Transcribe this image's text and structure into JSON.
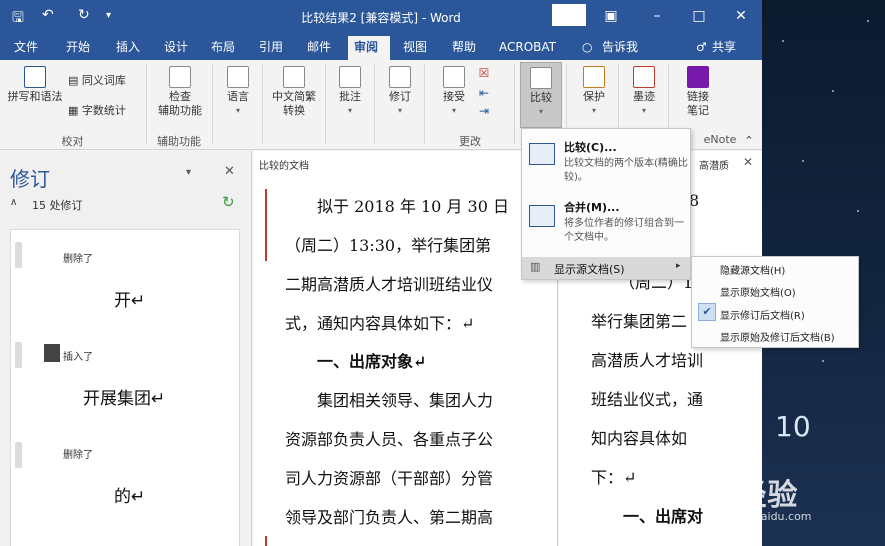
{
  "window": {
    "title": "比较结果2 [兼容模式] - Word",
    "tabs": [
      {
        "label": "文件"
      },
      {
        "label": "开始"
      },
      {
        "label": "插入"
      },
      {
        "label": "设计"
      },
      {
        "label": "布局"
      },
      {
        "label": "引用"
      },
      {
        "label": "邮件"
      },
      {
        "label": "审阅"
      },
      {
        "label": "视图"
      },
      {
        "label": "帮助"
      },
      {
        "label": "ACROBAT"
      },
      {
        "label": "告诉我"
      }
    ],
    "share": "共享"
  },
  "ribbon": {
    "spelling": "拼写和语法",
    "thesaurus": "同义词库",
    "wordcount": "字数统计",
    "proofing_group": "校对",
    "accessibility_line1": "检查",
    "accessibility_line2": "辅助功能",
    "accessibility_group": "辅助功能",
    "language": "语言",
    "chinese_line1": "中文简繁",
    "chinese_line2": "转换",
    "comments": "批注",
    "tracking": "修订",
    "accept": "接受",
    "changes_group": "更改",
    "compare": "比较",
    "protect": "保护",
    "ink": "墨迹",
    "linked_line1": "链接",
    "linked_line2": "笔记",
    "onenote_group": "eNote"
  },
  "revisions_pane": {
    "title": "修订",
    "count": "15 处修订",
    "items": [
      {
        "action": "删除了",
        "text": "开↵"
      },
      {
        "action": "插入了",
        "text": "开展集团↵"
      },
      {
        "action": "删除了",
        "text": "的↵"
      }
    ]
  },
  "compared_doc": {
    "header": "比较的文档",
    "lines": [
      "拟于 2018 年 10 月 30 日",
      "（周二）13:30，举行集团第",
      "二期高潜质人才培训班结业仪",
      "式，通知内容具体如下：↵",
      "一、出席对象↵",
      "集团相关领导、集团人力",
      "资源部负责人员、各重点子公",
      "司人力资源部（干部部）分管",
      "领导及部门负责人、第二期高"
    ]
  },
  "source_doc": {
    "header": "高潜质",
    "lines": [
      "8",
      "（周二）13:3",
      "举行集团第二",
      "高潜质人才培训",
      "班结业仪式，通",
      "知内容具体如",
      "下：↵",
      "一、出席对"
    ]
  },
  "compare_menu": {
    "compare_title": "比较(C)...",
    "compare_desc": "比较文档的两个版本(精确比较)。",
    "combine_title": "合并(M)...",
    "combine_desc": "将多位作者的修订组合到一个文档中。",
    "show_source": "显示源文档(S)"
  },
  "submenu": {
    "items": [
      "隐藏源文档(H)",
      "显示原始文档(O)",
      "显示修订后文档(R)",
      "显示原始及修订后文档(B)"
    ],
    "checked_index": 2
  },
  "desktop": {
    "clock": "10",
    "watermark_brand": "Bai经验",
    "watermark_url": "jingyan.baidu.com"
  }
}
